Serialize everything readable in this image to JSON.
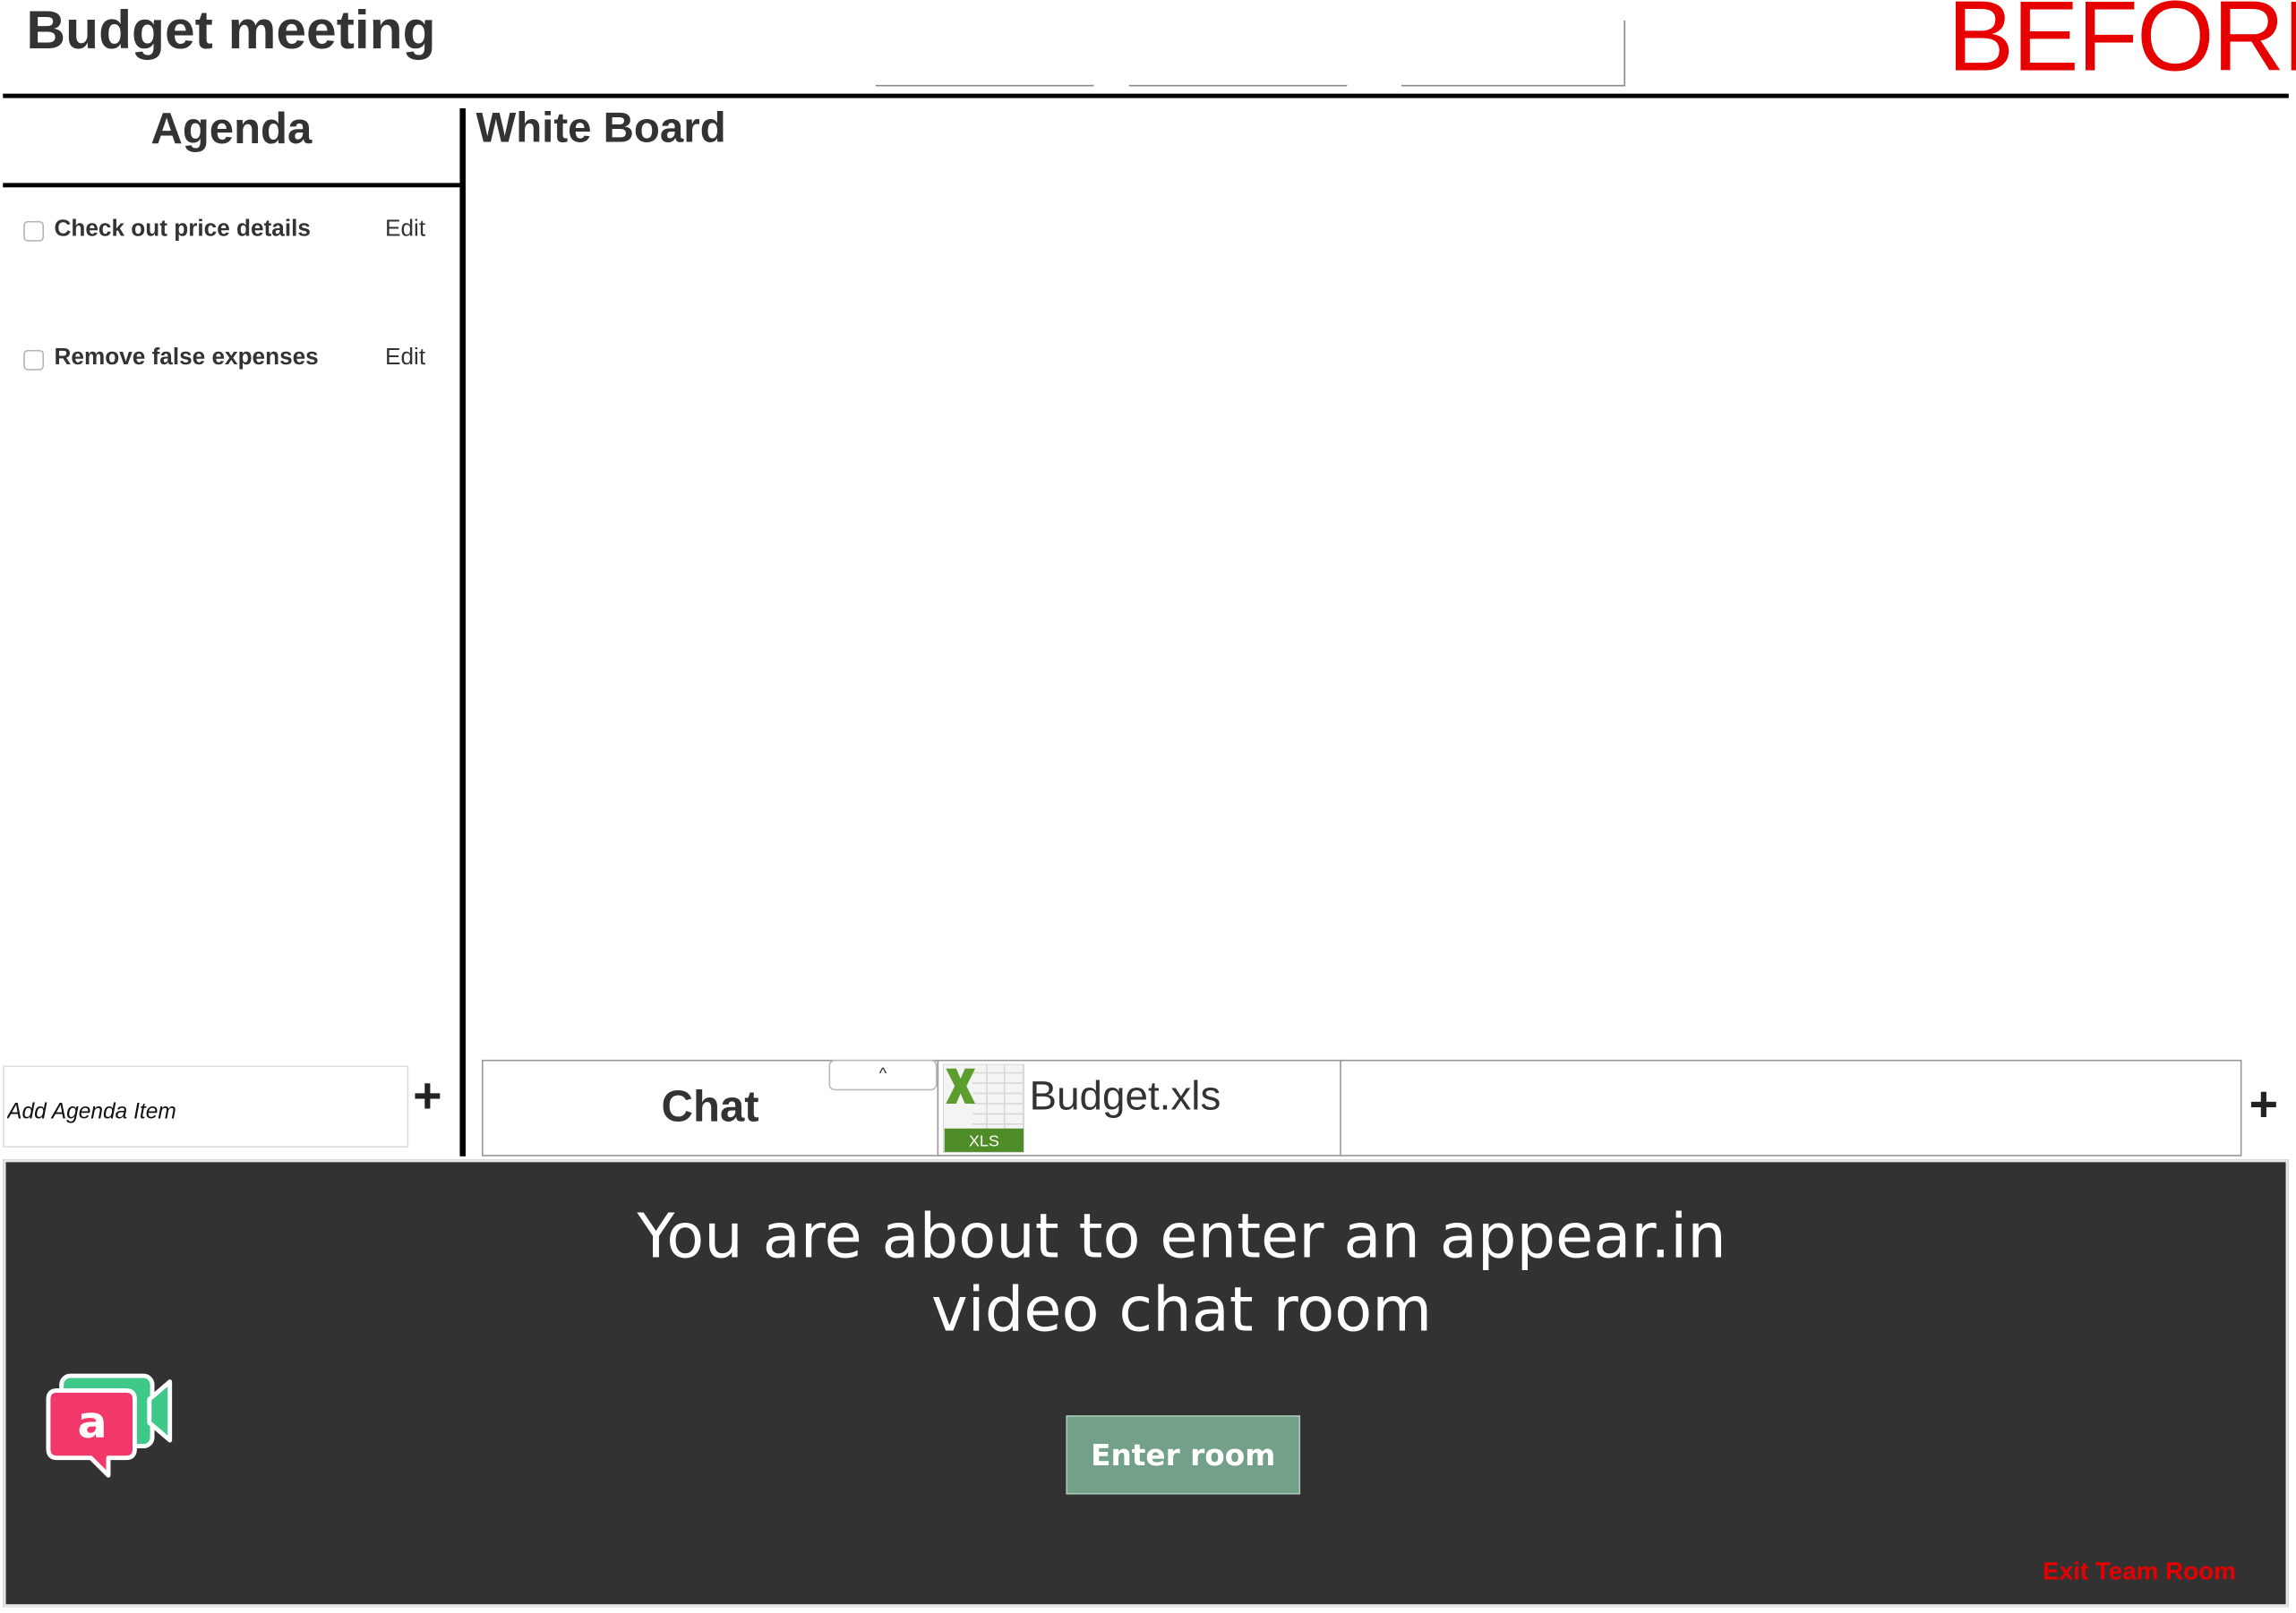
{
  "header": {
    "meeting_title": "Budget meeting",
    "stage_label": "BEFORE"
  },
  "agenda": {
    "heading": "Agenda",
    "items": [
      {
        "label": "Check out price details",
        "edit_label": "Edit",
        "checked": false
      },
      {
        "label": "Remove false expenses",
        "edit_label": "Edit",
        "checked": false
      }
    ],
    "add_placeholder": "Add Agenda Item",
    "add_button_symbol": "+"
  },
  "whiteboard": {
    "heading": "White Board"
  },
  "tabs": {
    "chat_label": "Chat",
    "collapse_symbol": "^",
    "file_name": "Budget.xls",
    "file_badge": "XLS",
    "add_button_symbol": "+"
  },
  "video_banner": {
    "heading_line1": "You are about to enter an appear.in",
    "heading_line2": "video chat room",
    "logo_letter": "a",
    "enter_button": "Enter room",
    "exit_link": "Exit Team Room"
  },
  "colors": {
    "stage_label": "#e60000",
    "banner_background": "#323232",
    "enter_button": "#73a088",
    "exit_link": "#e60000",
    "logo_pink": "#f2376a",
    "logo_green": "#3ec98a",
    "excel_green": "#5c9e2e"
  }
}
